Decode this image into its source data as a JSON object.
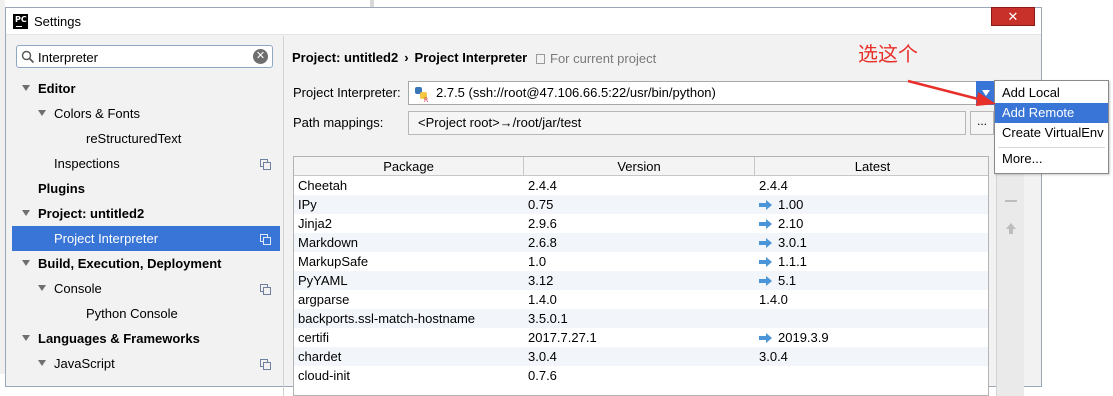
{
  "window": {
    "title": "Settings",
    "app_logo_text": "PC",
    "close_glyph": "✕"
  },
  "search": {
    "value": "Interpreter",
    "clear_glyph": "✕"
  },
  "tree": [
    {
      "label": "Editor",
      "bold": true,
      "arrow": true,
      "indent": 0
    },
    {
      "label": "Colors & Fonts",
      "bold": false,
      "arrow": true,
      "indent": 1
    },
    {
      "label": "reStructuredText",
      "bold": false,
      "arrow": false,
      "indent": 2
    },
    {
      "label": "Inspections",
      "bold": false,
      "arrow": false,
      "indent": 1,
      "copy": true
    },
    {
      "label": "Plugins",
      "bold": true,
      "arrow": false,
      "indent": 0
    },
    {
      "label": "Project: untitled2",
      "bold": true,
      "arrow": true,
      "indent": 0
    },
    {
      "label": "Project Interpreter",
      "bold": false,
      "arrow": false,
      "indent": 1,
      "copy": true,
      "selected": true
    },
    {
      "label": "Build, Execution, Deployment",
      "bold": true,
      "arrow": true,
      "indent": 0
    },
    {
      "label": "Console",
      "bold": false,
      "arrow": true,
      "indent": 1,
      "copy": true
    },
    {
      "label": "Python Console",
      "bold": false,
      "arrow": false,
      "indent": 2
    },
    {
      "label": "Languages & Frameworks",
      "bold": true,
      "arrow": true,
      "indent": 0
    },
    {
      "label": "JavaScript",
      "bold": false,
      "arrow": true,
      "indent": 1,
      "copy": true
    }
  ],
  "breadcrumb": {
    "project": "Project: untitled2",
    "separator": "›",
    "page": "Project Interpreter"
  },
  "scope_text": "For current project",
  "interpreter": {
    "label": "Project Interpreter:",
    "value": "2.7.5 (ssh://root@47.106.66.5:22/usr/bin/python)"
  },
  "path_mappings": {
    "label": "Path mappings:",
    "value": "<Project root>→/root/jar/test",
    "browse_label": "..."
  },
  "packages": {
    "headers": [
      "Package",
      "Version",
      "Latest"
    ],
    "rows": [
      {
        "package": "Cheetah",
        "version": "2.4.4",
        "latest": "2.4.4",
        "upgrade": false
      },
      {
        "package": "IPy",
        "version": "0.75",
        "latest": "1.00",
        "upgrade": true
      },
      {
        "package": "Jinja2",
        "version": "2.9.6",
        "latest": "2.10",
        "upgrade": true
      },
      {
        "package": "Markdown",
        "version": "2.6.8",
        "latest": "3.0.1",
        "upgrade": true
      },
      {
        "package": "MarkupSafe",
        "version": "1.0",
        "latest": "1.1.1",
        "upgrade": true
      },
      {
        "package": "PyYAML",
        "version": "3.12",
        "latest": "5.1",
        "upgrade": true
      },
      {
        "package": "argparse",
        "version": "1.4.0",
        "latest": "1.4.0",
        "upgrade": false
      },
      {
        "package": "backports.ssl-match-hostname",
        "version": "3.5.0.1",
        "latest": "",
        "upgrade": false
      },
      {
        "package": "certifi",
        "version": "2017.7.27.1",
        "latest": "2019.3.9",
        "upgrade": true
      },
      {
        "package": "chardet",
        "version": "3.0.4",
        "latest": "3.0.4",
        "upgrade": false
      },
      {
        "package": "cloud-init",
        "version": "0.7.6",
        "latest": "",
        "upgrade": false
      }
    ]
  },
  "popup_menu": {
    "items": [
      {
        "label": "Add Local",
        "active": false
      },
      {
        "label": "Add Remote",
        "active": true
      },
      {
        "label": "Create VirtualEnv",
        "active": false
      },
      {
        "label": "More...",
        "active": false
      }
    ]
  },
  "annotation": {
    "text": "选这个",
    "color": "#e8302a"
  },
  "colors": {
    "selection": "#3875d7",
    "upgrade_arrow": "#4a95d8"
  }
}
